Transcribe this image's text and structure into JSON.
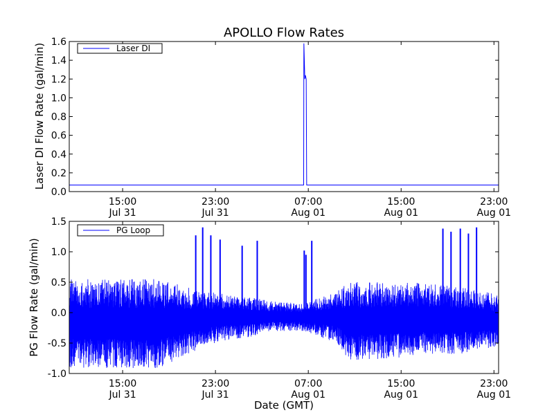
{
  "title": "APOLLO Flow Rates",
  "xlabel": "Date (GMT)",
  "x_ticks": [
    {
      "label_time": "15:00",
      "label_date": "Jul 31",
      "hours": 15
    },
    {
      "label_time": "23:00",
      "label_date": "Jul 31",
      "hours": 23
    },
    {
      "label_time": "07:00",
      "label_date": "Aug 01",
      "hours": 31
    },
    {
      "label_time": "15:00",
      "label_date": "Aug 01",
      "hours": 39
    },
    {
      "label_time": "23:00",
      "label_date": "Aug 01",
      "hours": 47
    }
  ],
  "chart_data": [
    {
      "type": "line",
      "ylabel": "Laser DI Flow Rate (gal/min)",
      "xlim_hours": [
        10.4,
        47.4
      ],
      "ylim": [
        0.0,
        1.6
      ],
      "yticks": [
        "0.0",
        "0.2",
        "0.4",
        "0.6",
        "0.8",
        "1.0",
        "1.2",
        "1.4",
        "1.6"
      ],
      "legend": {
        "label": "Laser DI",
        "position": "upper-left"
      },
      "series": [
        {
          "name": "Laser DI",
          "color": "#0000ff",
          "baseline": 0.07,
          "points": [
            [
              10.4,
              0.07
            ],
            [
              30.0,
              0.07
            ],
            [
              30.6,
              0.07
            ],
            [
              30.62,
              1.58
            ],
            [
              30.7,
              1.2
            ],
            [
              30.75,
              1.24
            ],
            [
              30.82,
              1.2
            ],
            [
              30.86,
              0.07
            ],
            [
              47.4,
              0.07
            ]
          ]
        }
      ]
    },
    {
      "type": "line",
      "ylabel": "PG Flow Rate (gal/min)",
      "xlim_hours": [
        10.4,
        47.4
      ],
      "ylim": [
        -1.0,
        1.5
      ],
      "yticks": [
        "-1.0",
        "-0.5",
        "0.0",
        "0.5",
        "1.0",
        "1.5"
      ],
      "legend": {
        "label": "PG Loop",
        "position": "upper-left"
      },
      "series": [
        {
          "name": "PG Loop",
          "color": "#0000ff",
          "envelope": [
            {
              "hours": 10.4,
              "low": -0.9,
              "high": 0.55
            },
            {
              "hours": 18.0,
              "low": -0.92,
              "high": 0.55
            },
            {
              "hours": 20.0,
              "low": -0.75,
              "high": 0.45
            },
            {
              "hours": 22.0,
              "low": -0.55,
              "high": 0.35
            },
            {
              "hours": 24.0,
              "low": -0.45,
              "high": 0.3
            },
            {
              "hours": 26.0,
              "low": -0.4,
              "high": 0.25
            },
            {
              "hours": 28.0,
              "low": -0.3,
              "high": 0.18
            },
            {
              "hours": 30.5,
              "low": -0.3,
              "high": 0.15
            },
            {
              "hours": 32.0,
              "low": -0.4,
              "high": 0.25
            },
            {
              "hours": 33.5,
              "low": -0.5,
              "high": 0.35
            },
            {
              "hours": 34.5,
              "low": -0.8,
              "high": 0.5
            },
            {
              "hours": 36.0,
              "low": -0.78,
              "high": 0.5
            },
            {
              "hours": 40.0,
              "low": -0.72,
              "high": 0.5
            },
            {
              "hours": 44.0,
              "low": -0.68,
              "high": 0.42
            },
            {
              "hours": 47.4,
              "low": -0.55,
              "high": 0.3
            }
          ],
          "spikes": [
            {
              "hours": 21.3,
              "peak": 1.27
            },
            {
              "hours": 21.9,
              "peak": 1.4
            },
            {
              "hours": 22.6,
              "peak": 1.27
            },
            {
              "hours": 23.4,
              "peak": 1.2
            },
            {
              "hours": 25.3,
              "peak": 1.1
            },
            {
              "hours": 26.6,
              "peak": 1.18
            },
            {
              "hours": 30.65,
              "peak": 1.02
            },
            {
              "hours": 30.8,
              "peak": 0.95
            },
            {
              "hours": 31.3,
              "peak": 1.18
            },
            {
              "hours": 42.6,
              "peak": 1.38
            },
            {
              "hours": 43.3,
              "peak": 1.33
            },
            {
              "hours": 44.1,
              "peak": 1.38
            },
            {
              "hours": 44.8,
              "peak": 1.3
            },
            {
              "hours": 45.5,
              "peak": 1.4
            }
          ]
        }
      ]
    }
  ]
}
